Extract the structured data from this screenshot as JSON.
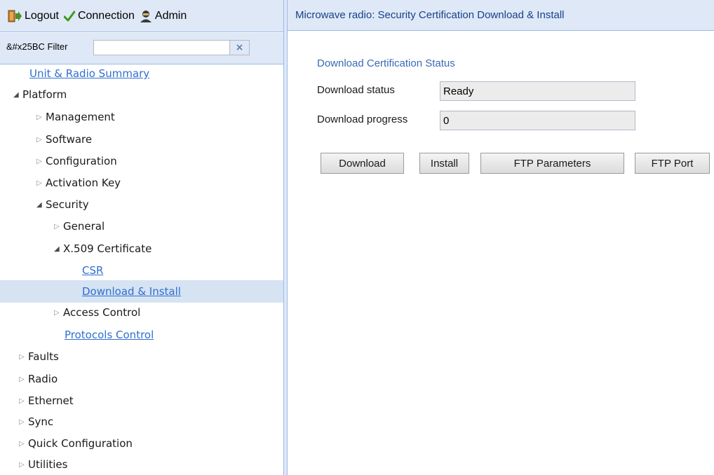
{
  "topbar": {
    "logout_label": "Logout",
    "logout_icon": "logout-door-icon",
    "connection_label": "Connection",
    "connection_icon": "checkmark-icon",
    "admin_label": "Admin",
    "admin_icon": "user-icon"
  },
  "filter": {
    "label": "&#x25BC Filter",
    "value": "",
    "clear_symbol": "×"
  },
  "tree": {
    "unit_radio_summary": "Unit & Radio Summary",
    "platform": "Platform",
    "management": "Management",
    "software": "Software",
    "configuration": "Configuration",
    "activation_key": "Activation Key",
    "security": "Security",
    "general": "General",
    "x509_certificate": "X.509 Certificate",
    "csr": "CSR",
    "download_install": "Download & Install",
    "access_control": "Access Control",
    "protocols_control": "Protocols Control",
    "faults": "Faults",
    "radio": "Radio",
    "ethernet": "Ethernet",
    "sync": "Sync",
    "quick_configuration": "Quick Configuration",
    "utilities": "Utilities"
  },
  "main": {
    "header_title": "Microwave radio: Security Certification Download & Install",
    "section_title": "Download Certification Status",
    "download_status_label": "Download status",
    "download_status_value": "Ready",
    "download_progress_label": "Download progress",
    "download_progress_value": "0",
    "buttons": {
      "download": "Download",
      "install": "Install",
      "ftp_parameters": "FTP Parameters",
      "ftp_port": "FTP Port"
    }
  },
  "colors": {
    "panel_bg": "#dfe8f6",
    "selected_row": "#d6e3f2",
    "link": "#2f6fd0",
    "header_text": "#15428b"
  }
}
